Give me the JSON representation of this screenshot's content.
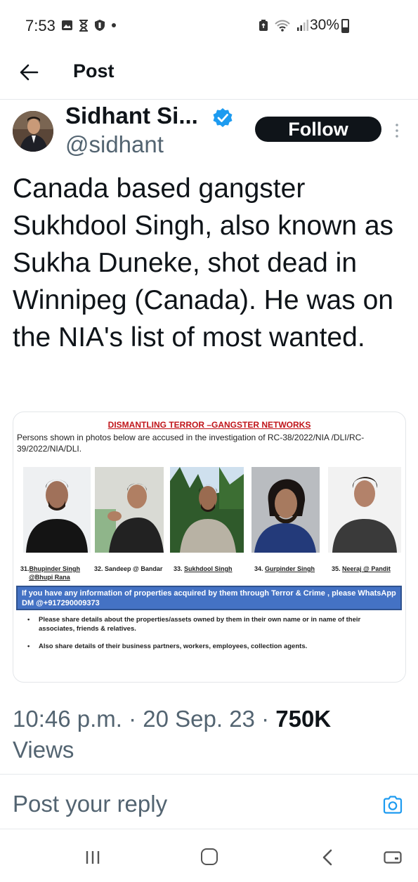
{
  "status_bar": {
    "time": "7:53",
    "battery": "30%",
    "icons_left": [
      "image-icon",
      "hourglass-icon",
      "shield-icon",
      "dot-icon"
    ],
    "icons_right": [
      "nfc-icon",
      "wifi-icon",
      "signal-icon",
      "battery-icon"
    ]
  },
  "header": {
    "title": "Post"
  },
  "author": {
    "name": "Sidhant Si...",
    "handle": "@sidhant",
    "verified": true,
    "follow_label": "Follow"
  },
  "tweet": {
    "text": "Canada based gangster Sukhdool Singh, also known as Sukha Duneke, shot dead in Winnipeg (Canada). He was on the NIA's list of most wanted."
  },
  "media": {
    "title": "DISMANTLING TERROR –GANGSTER NETWORKS",
    "subtitle": "Persons shown in photos below are accused in the investigation of RC-38/2022/NIA   /DLI/RC-39/2022/NIA/DLI.",
    "persons": [
      {
        "number": "31.",
        "name": "Bhupinder Singh",
        "alias": "@Bhupi Rana"
      },
      {
        "number": "32.",
        "name": "Sandeep @ Bandar",
        "alias": ""
      },
      {
        "number": "33.",
        "name": "Sukhdool Singh",
        "alias": ""
      },
      {
        "number": "34.",
        "name": "Gurpinder Singh",
        "alias": ""
      },
      {
        "number": "35.",
        "name": "Neeraj @ Pandit",
        "alias": ""
      }
    ],
    "info": "If you have any information  of properties  acquired by them through Terror & Crime , please WhatsApp DM @+917290009373",
    "bullets": [
      "Please share details  about the properties/assets owned by them in their own name or in name of their associates, friends & relatives.",
      "Also share details of their business partners, workers, employees, collection agents."
    ],
    "colors": {
      "title_red": "#c0151a",
      "info_blue": "#4472c4"
    }
  },
  "meta": {
    "time": "10:46 p.m.",
    "date": "20 Sep. 23",
    "views_count": "750K",
    "views_label": "Views"
  },
  "reply": {
    "placeholder": "Post your reply"
  },
  "colors": {
    "accent": "#1d9bf0",
    "text": "#0f1419",
    "secondary": "#536471"
  }
}
